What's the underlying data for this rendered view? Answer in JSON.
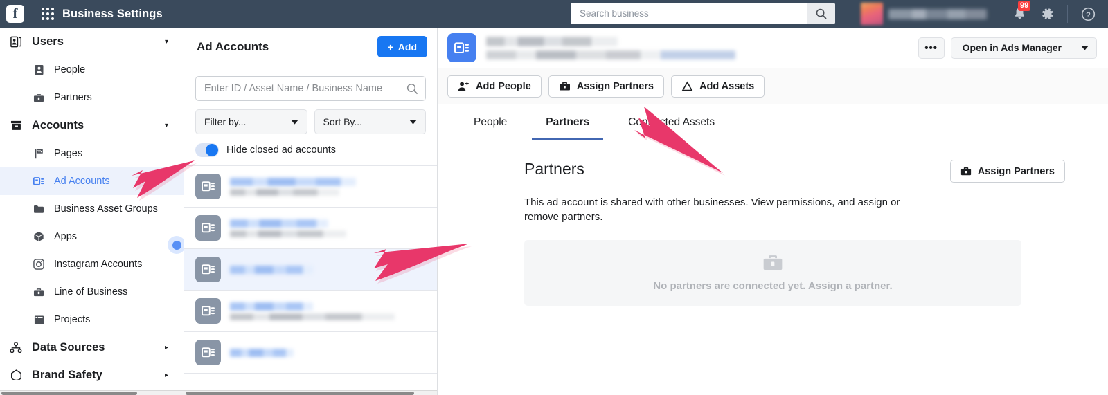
{
  "topbar": {
    "logo": "facebook-logo",
    "app_title": "Business Settings",
    "search": {
      "placeholder": "Search business",
      "value": ""
    },
    "notifications_badge": "99",
    "icons": [
      "grid-icon",
      "search-icon",
      "bell-icon",
      "gear-icon",
      "help-icon"
    ]
  },
  "sidebar": {
    "groups": [
      {
        "label": "Users",
        "icon": "users-icon",
        "caret": "▾",
        "items": [
          {
            "label": "People",
            "icon": "person-icon"
          },
          {
            "label": "Partners",
            "icon": "briefcase-icon"
          }
        ]
      },
      {
        "label": "Accounts",
        "icon": "archive-icon",
        "caret": "▾",
        "items": [
          {
            "label": "Pages",
            "icon": "flag-icon"
          },
          {
            "label": "Ad Accounts",
            "icon": "ad-account-icon",
            "active": true
          },
          {
            "label": "Business Asset Groups",
            "icon": "folder-icon"
          },
          {
            "label": "Apps",
            "icon": "cube-icon"
          },
          {
            "label": "Instagram Accounts",
            "icon": "instagram-icon"
          },
          {
            "label": "Line of Business",
            "icon": "briefcase-icon"
          },
          {
            "label": "Projects",
            "icon": "projects-icon"
          }
        ]
      },
      {
        "label": "Data Sources",
        "icon": "data-sources-icon",
        "caret": "▸",
        "items": []
      },
      {
        "label": "Brand Safety",
        "icon": "shield-icon",
        "caret": "▸",
        "items": []
      }
    ]
  },
  "middle": {
    "title": "Ad Accounts",
    "add_label": "Add",
    "add_plus": "+",
    "search": {
      "placeholder": "Enter ID / Asset Name / Business Name",
      "value": ""
    },
    "filter_label": "Filter by...",
    "sort_label": "Sort By...",
    "toggle_label": "Hide closed ad accounts",
    "toggle_on": true,
    "accounts": [
      {
        "name": "",
        "subtitle": "",
        "selected": false,
        "name_w": 182,
        "sub_w": 158
      },
      {
        "name": "",
        "subtitle": "",
        "selected": false,
        "name_w": 142,
        "sub_w": 168
      },
      {
        "name": "",
        "subtitle": "",
        "selected": true,
        "name_w": 120,
        "sub_w": 0
      },
      {
        "name": "",
        "subtitle": "",
        "selected": false,
        "name_w": 120,
        "sub_w": 238
      },
      {
        "name": "",
        "subtitle": "",
        "selected": false,
        "name_w": 92,
        "sub_w": 0
      }
    ]
  },
  "detail": {
    "account_icon": "ad-account-icon",
    "account_name": "",
    "account_subtitle": "",
    "more_label": "•••",
    "open_label": "Open in Ads Manager",
    "open_caret": "▼",
    "action_buttons": [
      {
        "label": "Add People",
        "icon": "add-person-icon"
      },
      {
        "label": "Assign Partners",
        "icon": "briefcase-icon"
      },
      {
        "label": "Add Assets",
        "icon": "add-assets-icon"
      }
    ],
    "tabs": [
      {
        "label": "People",
        "active": false
      },
      {
        "label": "Partners",
        "active": true
      },
      {
        "label": "Connected Assets",
        "active": false
      }
    ],
    "panel": {
      "title": "Partners",
      "assign_label": "Assign Partners",
      "assign_icon": "briefcase-icon",
      "description": "This ad account is shared with other businesses. View permissions, and assign or remove partners.",
      "empty_icon": "briefcase-icon",
      "empty_text": "No partners are connected yet. Assign a partner."
    }
  },
  "annotations": {
    "arrow_color": "#e8376a",
    "arrows": [
      "arrow-to-ad-accounts",
      "arrow-to-selected-account",
      "arrow-to-assign-partners"
    ],
    "cursor_indicator": "click-indicator-dot"
  },
  "colors": {
    "topbar_bg": "#3a4a5c",
    "primary_blue": "#1877f2",
    "accent_blue": "#4680f0",
    "tab_underline": "#4267b2",
    "badge_red": "#fa3e3e",
    "arrow_pink": "#e8376a"
  }
}
